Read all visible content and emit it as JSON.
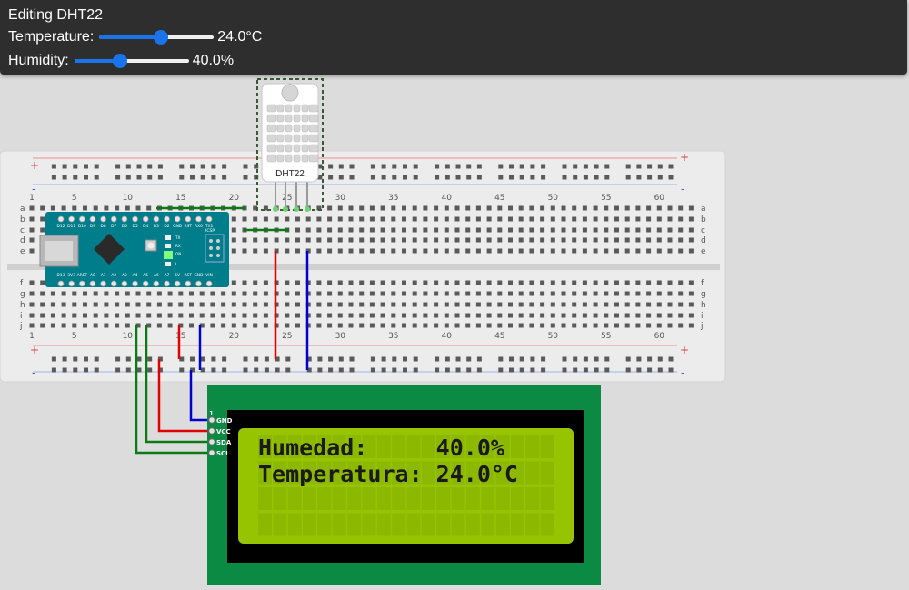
{
  "editor": {
    "title": "Editing DHT22",
    "temperature": {
      "label": "Temperature:",
      "value": "24.0°C",
      "fraction": 0.54
    },
    "humidity": {
      "label": "Humidity:",
      "value": "40.0%",
      "fraction": 0.4
    }
  },
  "breadboard": {
    "top_numbers": [
      "1",
      "5",
      "10",
      "15",
      "20",
      "25",
      "30",
      "35",
      "40",
      "45",
      "50",
      "55",
      "60"
    ],
    "bottom_numbers": [
      "1",
      "5",
      "10",
      "15",
      "20",
      "25",
      "30",
      "35",
      "40",
      "45",
      "50",
      "55",
      "60"
    ],
    "rows_top": [
      "a",
      "b",
      "c",
      "d",
      "e"
    ],
    "rows_bottom": [
      "f",
      "g",
      "h",
      "i",
      "j"
    ],
    "plus": "+",
    "minus": "-"
  },
  "dht22": {
    "label": "DHT22"
  },
  "arduino": {
    "top_pins": [
      "D12",
      "D11",
      "D10",
      "D9",
      "D8",
      "D7",
      "D6",
      "D5",
      "D4",
      "D3",
      "D2",
      "GND",
      "RST",
      "RX0",
      "TX1"
    ],
    "bottom_pins": [
      "D13",
      "3V3",
      "AREF",
      "A0",
      "A1",
      "A2",
      "A3",
      "A4",
      "A5",
      "A6",
      "A7",
      "5V",
      "RST",
      "GND",
      "VIN"
    ],
    "icsp_label": "ICSP",
    "led_labels": [
      "TX",
      "RX",
      "ON",
      "L"
    ]
  },
  "lcd": {
    "pin_index": "1",
    "pins": [
      "GND",
      "VCC",
      "SDA",
      "SCL"
    ],
    "line1": "Humedad:     40.0%",
    "line2": "Temperatura: 24.0°C"
  },
  "colors": {
    "editor_bg": "#2e2e2e",
    "slider_blue": "#1a73e8",
    "wire_red": "#e00000",
    "wire_blue": "#0000cc",
    "wire_green": "#0a7a12",
    "arduino_teal": "#007d8a",
    "lcd_green": "#96c400",
    "pcb_green": "#0a8a43"
  }
}
